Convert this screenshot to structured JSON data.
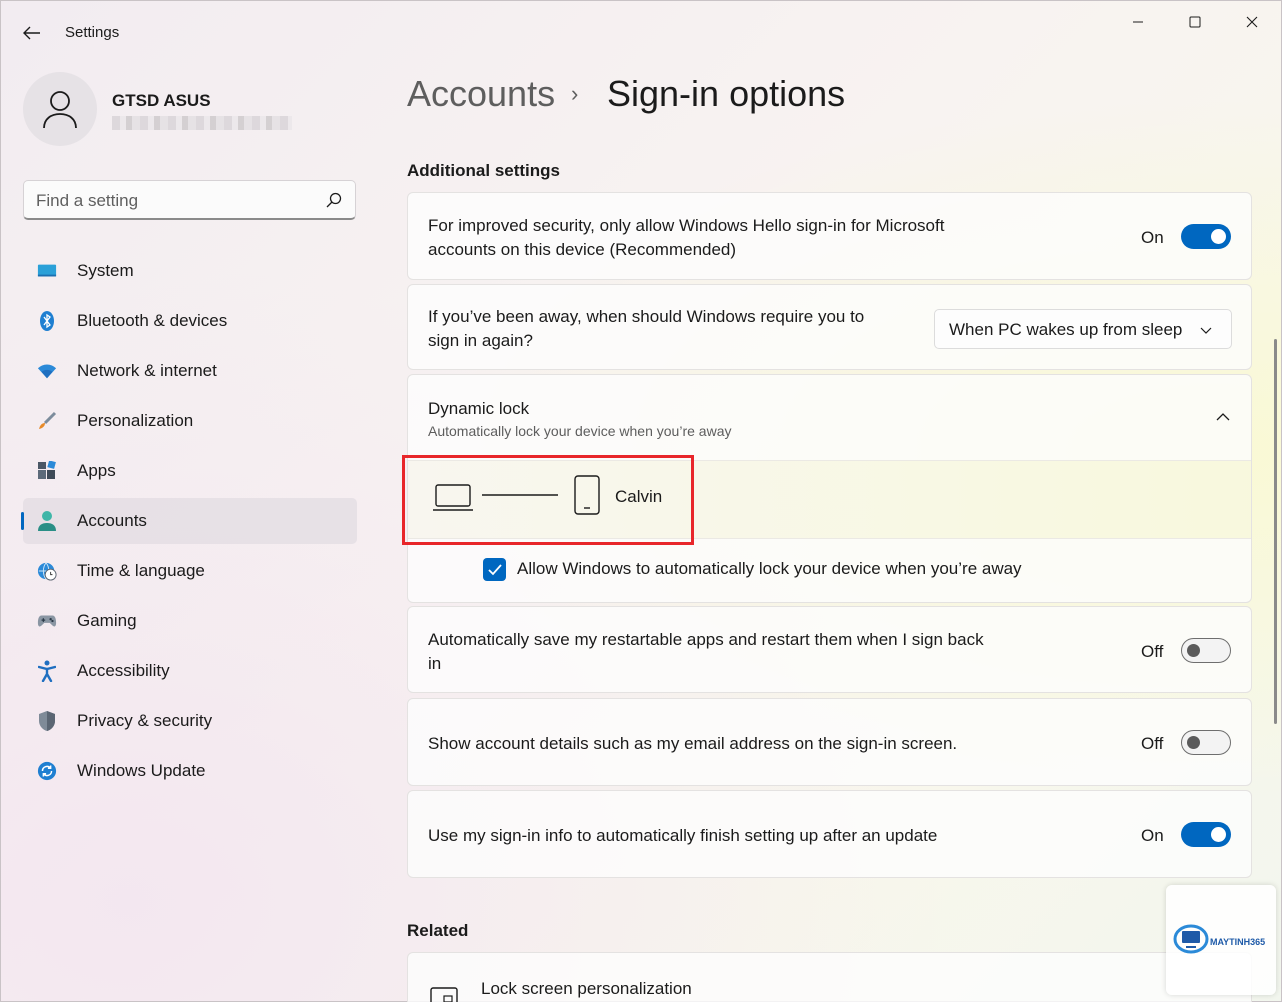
{
  "window": {
    "title": "Settings"
  },
  "profile": {
    "name": "GTSD ASUS"
  },
  "search": {
    "placeholder": "Find a setting"
  },
  "sidebar": {
    "items": [
      {
        "label": "System",
        "icon": "monitor-icon"
      },
      {
        "label": "Bluetooth & devices",
        "icon": "bluetooth-icon"
      },
      {
        "label": "Network & internet",
        "icon": "wifi-icon"
      },
      {
        "label": "Personalization",
        "icon": "brush-icon"
      },
      {
        "label": "Apps",
        "icon": "apps-icon"
      },
      {
        "label": "Accounts",
        "icon": "person-icon",
        "active": true
      },
      {
        "label": "Time & language",
        "icon": "globe-clock-icon"
      },
      {
        "label": "Gaming",
        "icon": "gamepad-icon"
      },
      {
        "label": "Accessibility",
        "icon": "accessibility-icon"
      },
      {
        "label": "Privacy & security",
        "icon": "shield-icon"
      },
      {
        "label": "Windows Update",
        "icon": "update-icon"
      }
    ]
  },
  "breadcrumb": {
    "parent": "Accounts",
    "separator": "›",
    "current": "Sign-in options"
  },
  "additional_settings": {
    "title": "Additional settings",
    "hello_only": {
      "line1": "For improved security, only allow Windows Hello sign-in for Microsoft",
      "line2": "accounts on this device (Recommended)",
      "state": "On"
    },
    "require_signin": {
      "line1": "If you’ve been away, when should Windows require you to",
      "line2": "sign in again?",
      "dropdown_value": "When PC wakes up from sleep"
    },
    "dynamic_lock": {
      "title": "Dynamic lock",
      "subtitle": "Automatically lock your device when you’re away",
      "paired_device": "Calvin",
      "checkbox_label": "Allow Windows to automatically lock your device when you’re away",
      "checked": true
    },
    "restart_apps": {
      "line1": "Automatically save my restartable apps and restart them when I sign back",
      "line2": "in",
      "state": "Off"
    },
    "account_details": {
      "text": "Show account details such as my email address on the sign-in screen.",
      "state": "Off"
    },
    "signin_info": {
      "text": "Use my sign-in info to automatically finish setting up after an update",
      "state": "On"
    }
  },
  "related": {
    "title": "Related",
    "lock_screen": "Lock screen personalization"
  },
  "watermark": {
    "brand": "MAYTINH365"
  },
  "colors": {
    "accent": "#0067c0",
    "highlight": "#e8262a"
  }
}
